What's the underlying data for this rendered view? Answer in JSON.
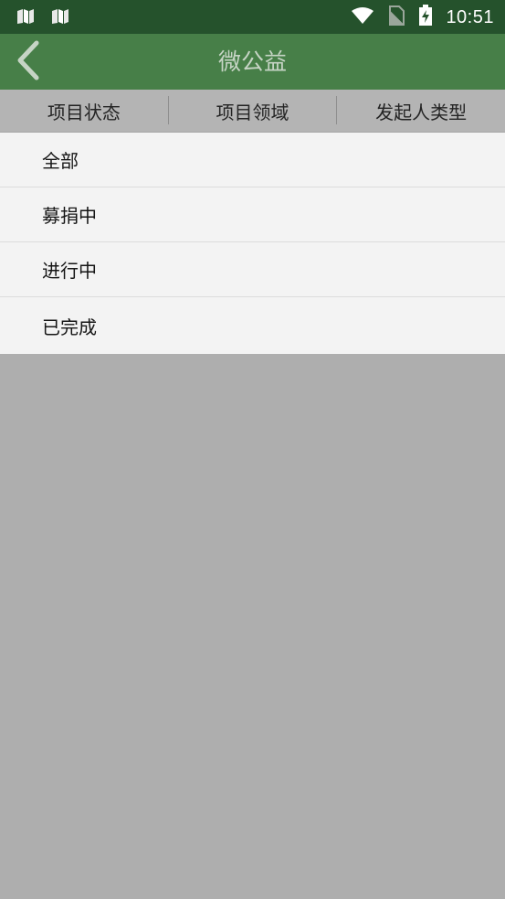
{
  "status_bar": {
    "time": "10:51",
    "left_icons": [
      "notification-app-icon",
      "notification-app-icon"
    ],
    "right_icons": [
      "wifi-icon",
      "no-sim-icon",
      "battery-charging-icon"
    ]
  },
  "app_bar": {
    "title": "微公益",
    "back_icon": "chevron-left-icon"
  },
  "filter_tabs": [
    {
      "label": "项目状态"
    },
    {
      "label": "项目领域"
    },
    {
      "label": "发起人类型"
    }
  ],
  "dropdown": {
    "items": [
      {
        "label": "全部"
      },
      {
        "label": "募捐中"
      },
      {
        "label": "进行中"
      },
      {
        "label": "已完成"
      }
    ]
  },
  "colors": {
    "status_bar": "#25522c",
    "app_bar": "#477f48",
    "filter_bar": "#b4b4b4",
    "dropdown_bg": "#f3f3f3",
    "dim_overlay": "#aeaeae"
  }
}
